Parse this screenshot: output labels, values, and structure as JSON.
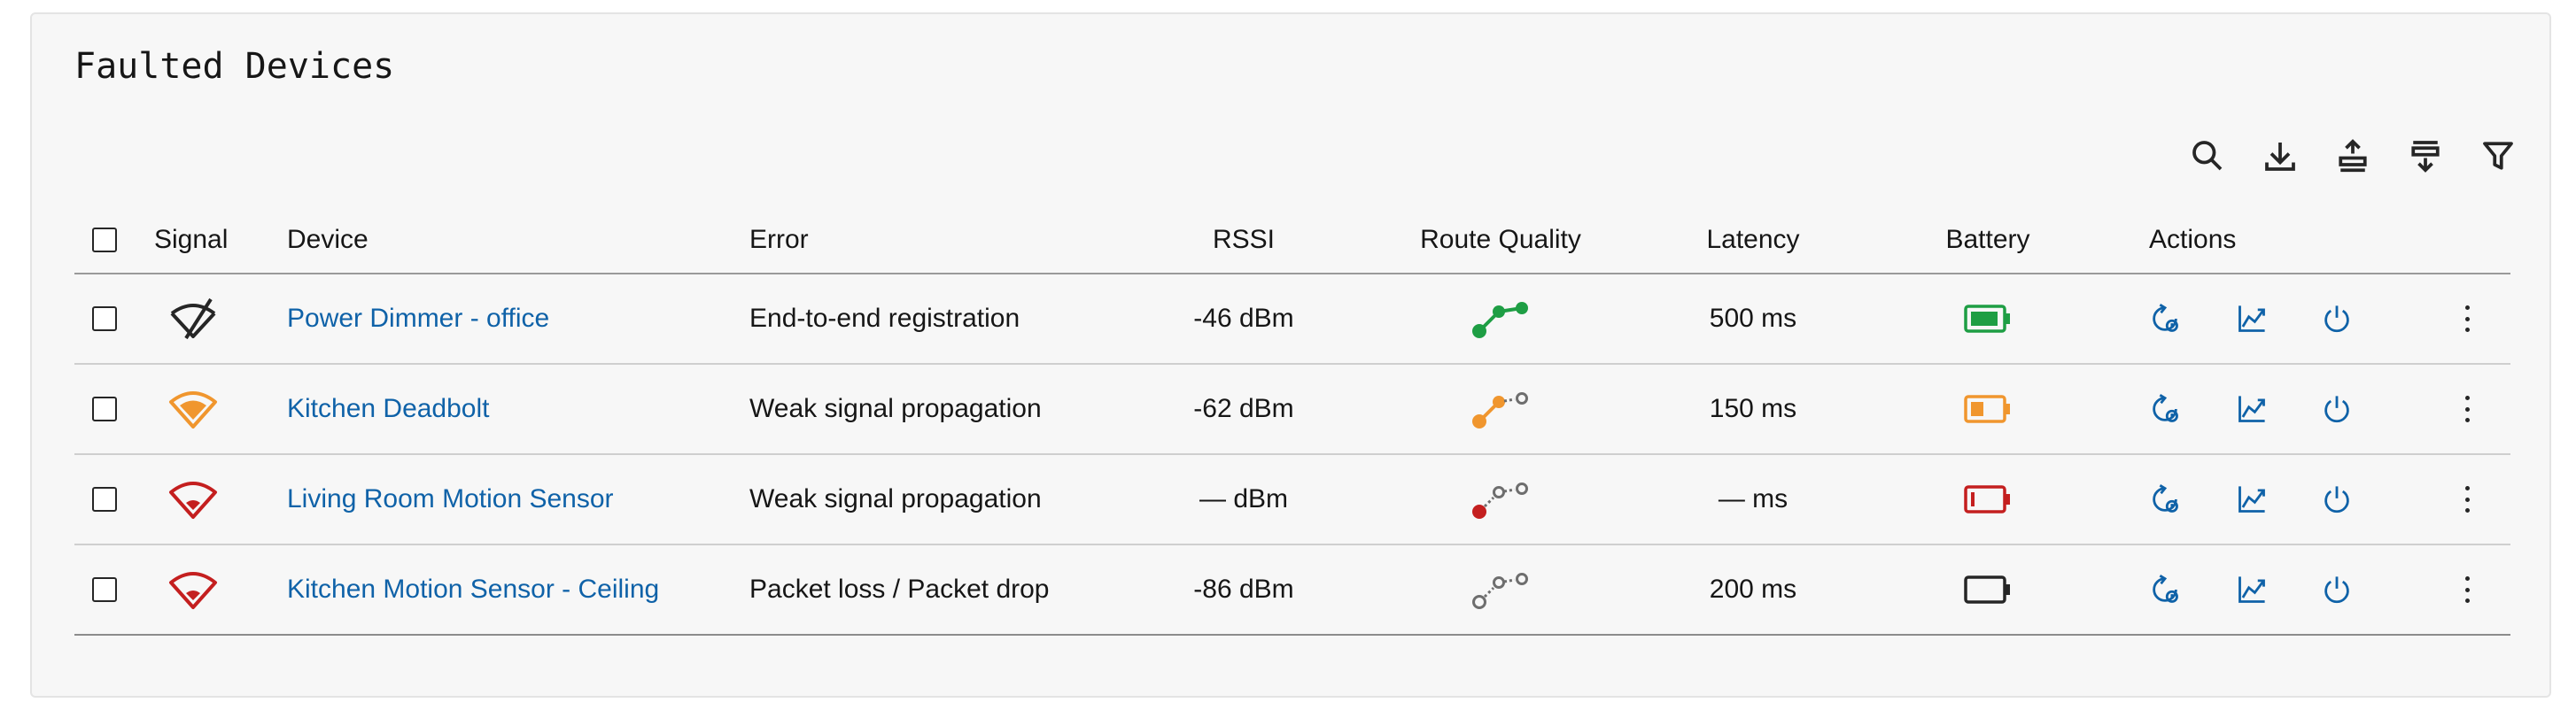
{
  "title": "Faulted Devices",
  "toolbar": {
    "icons": [
      "search-icon",
      "download-icon",
      "upload-icon",
      "column-settings-icon",
      "filter-icon"
    ]
  },
  "headers": {
    "signal": "Signal",
    "device": "Device",
    "error": "Error",
    "rssi": "RSSI",
    "route_quality": "Route Quality",
    "latency": "Latency",
    "battery": "Battery",
    "actions": "Actions"
  },
  "colors": {
    "good": "#1e9e44",
    "warn": "#f0962e",
    "bad": "#c41f1f",
    "neutral": "#6e6e6e",
    "link": "#0f62a8"
  },
  "rows": [
    {
      "signal": "no-signal",
      "device": "Power Dimmer - office",
      "error": "End-to-end registration",
      "rssi": "-46 dBm",
      "route_quality": "good",
      "latency": "500 ms",
      "battery": "full"
    },
    {
      "signal": "medium",
      "device": "Kitchen Deadbolt",
      "error": "Weak signal propagation",
      "rssi": "-62 dBm",
      "route_quality": "medium",
      "latency": "150 ms",
      "battery": "half"
    },
    {
      "signal": "weak",
      "device": "Living Room Motion Sensor",
      "error": "Weak signal propagation",
      "rssi": "— dBm",
      "route_quality": "poor",
      "latency": "— ms",
      "battery": "low"
    },
    {
      "signal": "weak",
      "device": "Kitchen Motion Sensor - Ceiling",
      "error": "Packet loss / Packet drop",
      "rssi": "-86 dBm",
      "route_quality": "unknown",
      "latency": "200 ms",
      "battery": "empty"
    }
  ],
  "row_actions": [
    "restart-icon",
    "chart-icon",
    "power-icon",
    "overflow-menu-icon"
  ]
}
